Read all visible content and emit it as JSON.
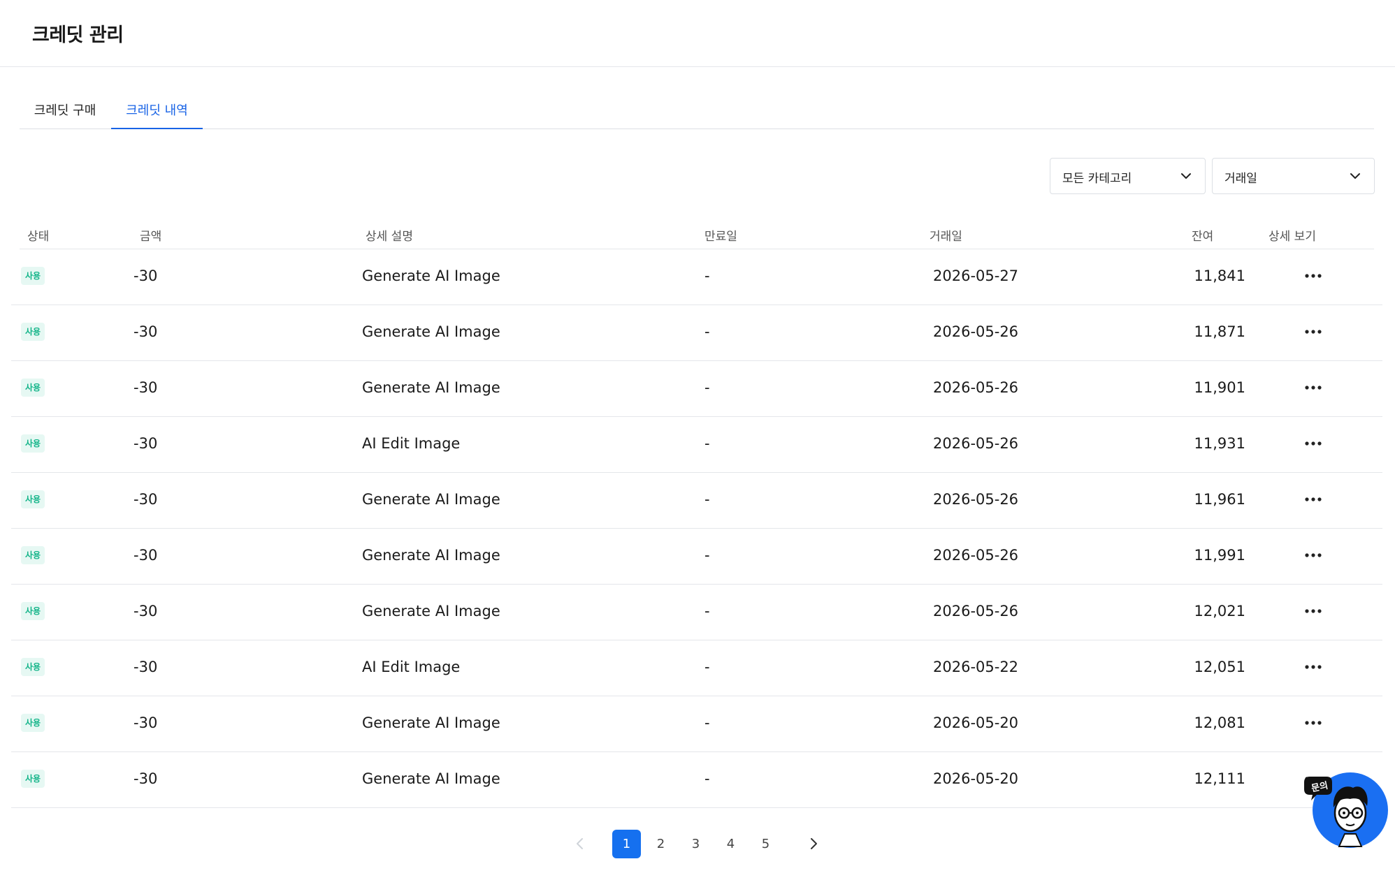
{
  "header": {
    "title": "크레딧 관리"
  },
  "tabs": [
    {
      "label": "크레딧 구매",
      "active": false
    },
    {
      "label": "크레딧 내역",
      "active": true
    }
  ],
  "filters": {
    "category": {
      "selected": "모든 카테고리",
      "icon": "chevron-down-icon"
    },
    "date": {
      "selected": "거래일",
      "icon": "chevron-down-icon"
    }
  },
  "table": {
    "columns": [
      "상태",
      "금액",
      "상세 설명",
      "만료일",
      "거래일",
      "잔여",
      "상세 보기"
    ],
    "rows": [
      {
        "status": "사용",
        "amount": "-30",
        "description": "Generate AI Image",
        "expiry": "-",
        "date": "2026-05-27",
        "balance": "11,841"
      },
      {
        "status": "사용",
        "amount": "-30",
        "description": "Generate AI Image",
        "expiry": "-",
        "date": "2026-05-26",
        "balance": "11,871"
      },
      {
        "status": "사용",
        "amount": "-30",
        "description": "Generate AI Image",
        "expiry": "-",
        "date": "2026-05-26",
        "balance": "11,901"
      },
      {
        "status": "사용",
        "amount": "-30",
        "description": "AI Edit Image",
        "expiry": "-",
        "date": "2026-05-26",
        "balance": "11,931"
      },
      {
        "status": "사용",
        "amount": "-30",
        "description": "Generate AI Image",
        "expiry": "-",
        "date": "2026-05-26",
        "balance": "11,961"
      },
      {
        "status": "사용",
        "amount": "-30",
        "description": "Generate AI Image",
        "expiry": "-",
        "date": "2026-05-26",
        "balance": "11,991"
      },
      {
        "status": "사용",
        "amount": "-30",
        "description": "Generate AI Image",
        "expiry": "-",
        "date": "2026-05-26",
        "balance": "12,021"
      },
      {
        "status": "사용",
        "amount": "-30",
        "description": "AI Edit Image",
        "expiry": "-",
        "date": "2026-05-22",
        "balance": "12,051"
      },
      {
        "status": "사용",
        "amount": "-30",
        "description": "Generate AI Image",
        "expiry": "-",
        "date": "2026-05-20",
        "balance": "12,081"
      },
      {
        "status": "사용",
        "amount": "-30",
        "description": "Generate AI Image",
        "expiry": "-",
        "date": "2026-05-20",
        "balance": "12,111"
      }
    ]
  },
  "pagination": {
    "pages": [
      "1",
      "2",
      "3",
      "4",
      "5"
    ],
    "current": "1",
    "prev_icon": "chevron-left-icon",
    "next_icon": "chevron-right-icon"
  },
  "chat_button": {
    "label": "문의",
    "icon": "avatar-icon"
  },
  "colors": {
    "accent": "#1570ef",
    "tab_active": "#1863e6",
    "badge_bg": "#e6f8f3",
    "badge_text": "#12b488",
    "fab_bg": "#1a6ff2"
  }
}
